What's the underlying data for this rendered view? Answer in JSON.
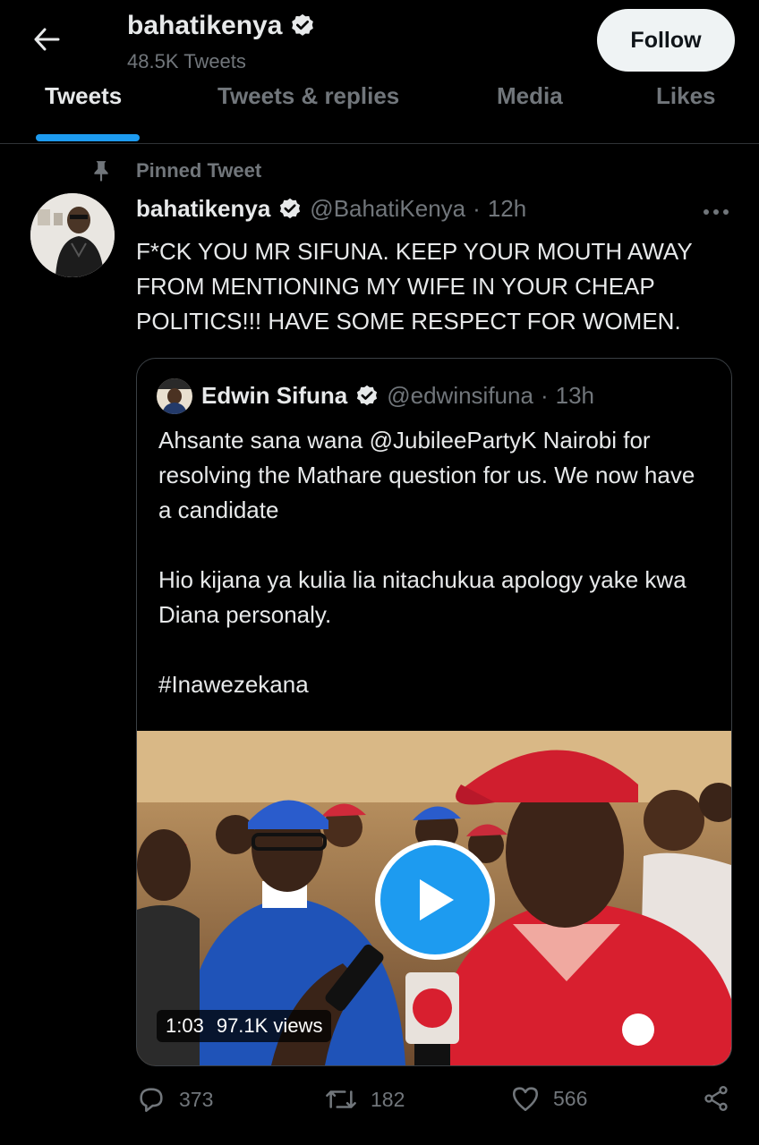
{
  "header": {
    "profile_name": "bahatikenya",
    "tweet_count": "48.5K Tweets",
    "follow_label": "Follow"
  },
  "tabs": [
    {
      "label": "Tweets",
      "active": true
    },
    {
      "label": "Tweets & replies",
      "active": false
    },
    {
      "label": "Media",
      "active": false
    },
    {
      "label": "Likes",
      "active": false
    }
  ],
  "tweet": {
    "pinned_label": "Pinned Tweet",
    "author_name": "bahatikenya",
    "author_handle": "@BahatiKenya",
    "time": "12h",
    "text": "F*CK YOU MR SIFUNA. KEEP YOUR MOUTH AWAY FROM MENTIONING MY WIFE IN YOUR CHEAP POLITICS!!! HAVE SOME RESPECT FOR WOMEN."
  },
  "quote": {
    "author_name": "Edwin Sifuna",
    "author_handle": "@edwinsifuna",
    "time": "13h",
    "paragraphs": [
      "Ahsante sana wana @JubileePartyK Nairobi for resolving the Mathare question for us. We now have a candidate",
      "Hio kijana ya kulia lia nitachukua apology yake kwa Diana personaly.",
      "#Inawezekana"
    ],
    "video_duration": "1:03",
    "video_views": "97.1K views"
  },
  "actions": {
    "replies": "373",
    "retweets": "182",
    "likes": "566"
  },
  "icons": {
    "verified_color": "#e7e9ea",
    "accent": "#1d9bf0"
  }
}
